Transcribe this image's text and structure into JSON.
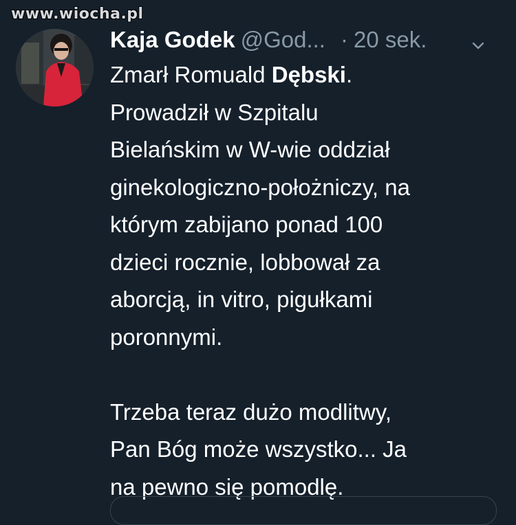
{
  "watermark": "www.wiocha.pl",
  "tweet": {
    "author_name": "Kaja Godek",
    "handle": "@God...",
    "separator": "·",
    "time": "20 sek.",
    "menu_icon": "chevron-down-icon",
    "avatar_icon": "avatar",
    "text": {
      "line1_a": "Zmarł Romuald ",
      "line1_b": "Dębski",
      "line1_c": ".",
      "line2": "Prowadził w Szpitalu",
      "line3": "Bielańskim w W-wie oddział",
      "line4": "ginekologiczno-położniczy, na",
      "line5": "którym zabijano ponad 100",
      "line6": "dzieci rocznie, lobbował za",
      "line7": "aborcją, in vitro, pigułkami",
      "line8": "poronnymi.",
      "line9": "Trzeba teraz dużo modlitwy,",
      "line10": "Pan Bóg może wszystko... Ja",
      "line11": "na pewno się pomodlę."
    }
  },
  "colors": {
    "background": "#15202b",
    "text_primary": "#ffffff",
    "text_secondary": "#8899a6",
    "border": "#38444d"
  }
}
